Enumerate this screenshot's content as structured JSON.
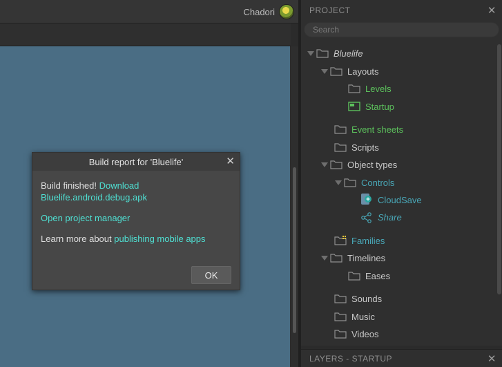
{
  "top": {
    "user_name": "Chadori"
  },
  "project_panel": {
    "title": "PROJECT",
    "search_placeholder": "Search",
    "tree": [
      {
        "label": "Bluelife",
        "color": "#c8c8c8",
        "italic": true,
        "expanded": true,
        "icon": "folder-icon"
      },
      {
        "label": "Layouts",
        "color": "#c8c8c8",
        "expanded": true,
        "icon": "folder-icon"
      },
      {
        "label": "Levels",
        "color": "#5cc05c",
        "icon": "folder-icon"
      },
      {
        "label": "Startup",
        "color": "#5cc05c",
        "icon": "layout-icon"
      },
      {
        "label": "Event sheets",
        "color": "#5cc05c",
        "icon": "folder-icon"
      },
      {
        "label": "Scripts",
        "color": "#c8c8c8",
        "icon": "folder-icon"
      },
      {
        "label": "Object types",
        "color": "#c8c8c8",
        "expanded": true,
        "icon": "folder-icon"
      },
      {
        "label": "Controls",
        "color": "#49a7b7",
        "expanded": true,
        "icon": "folder-icon"
      },
      {
        "label": "CloudSave",
        "color": "#49a7b7",
        "icon": "cloudsave-icon"
      },
      {
        "label": "Share",
        "color": "#49a7b7",
        "italic": true,
        "icon": "share-icon"
      },
      {
        "label": "Families",
        "color": "#49a7b7",
        "icon": "families-folder-icon"
      },
      {
        "label": "Timelines",
        "color": "#c8c8c8",
        "expanded": true,
        "icon": "folder-icon"
      },
      {
        "label": "Eases",
        "color": "#c8c8c8",
        "icon": "folder-icon"
      },
      {
        "label": "Sounds",
        "color": "#c8c8c8",
        "icon": "folder-icon"
      },
      {
        "label": "Music",
        "color": "#c8c8c8",
        "icon": "folder-icon"
      },
      {
        "label": "Videos",
        "color": "#c8c8c8",
        "icon": "folder-icon"
      }
    ]
  },
  "layers_panel": {
    "title": "LAYERS - STARTUP"
  },
  "dialog": {
    "title": "Build report for 'Bluelife'",
    "finished_text": "Build finished!",
    "download_link": "Download Bluelife.android.debug.apk",
    "project_manager_link": "Open project manager",
    "learn_more_text": "Learn more about",
    "publishing_link": "publishing mobile apps",
    "ok_label": "OK"
  },
  "colors": {
    "canvas": "#4a6d84",
    "link": "#4fe0d3",
    "green_item": "#5cc05c",
    "teal_item": "#49a7b7"
  }
}
